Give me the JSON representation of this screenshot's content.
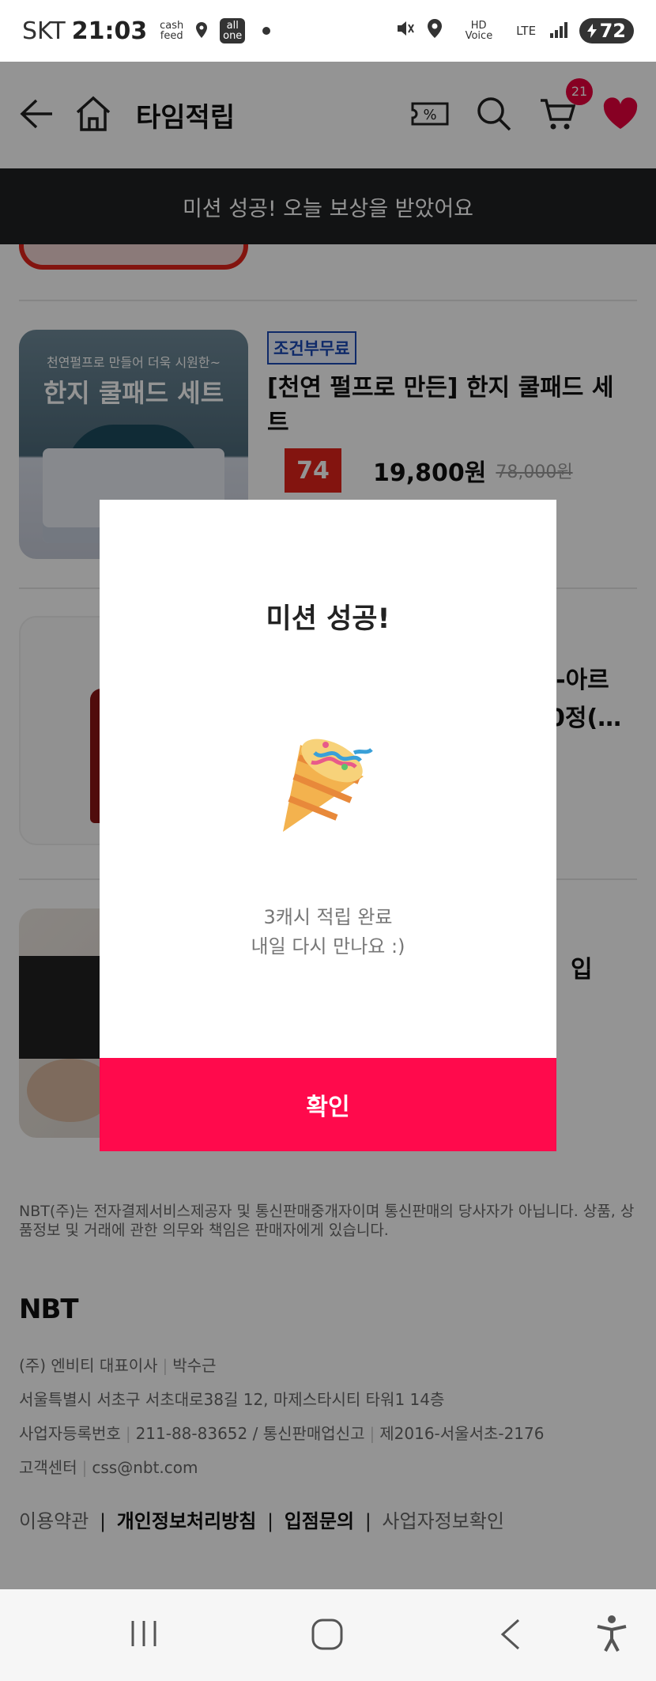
{
  "status_bar": {
    "carrier": "SKT",
    "time": "21:03",
    "mini_1": "cash feed",
    "mini_2": "all one",
    "net_1": "HD Voice",
    "net_2": "LTE",
    "battery": "72"
  },
  "header": {
    "title": "타임적립",
    "cart_count": "21",
    "coupon_symbol": "%"
  },
  "toast": {
    "text": "미션 성공! 오늘 보상을 받았어요"
  },
  "products": [
    {
      "thumb_line1": "천연펄프로 만들어 더욱 시원한~",
      "thumb_line2": "한지 쿨패드 세트",
      "tag": "조건부무료",
      "name": "[천연 펄프로 만든] 한지 쿨패드 세트",
      "discount": "74",
      "price": "19,800원",
      "original_price": "78,000원"
    },
    {
      "name_partial_1": "L-아르",
      "name_partial_2": "0정(…"
    },
    {
      "name_partial": "입"
    }
  ],
  "footer": {
    "notice": "NBT(주)는 전자결제서비스제공자 및 통신판매중개자이며 통신판매의 당사자가 아닙니다. 상품, 상품정보 및 거래에 관한 의무와 책임은 판매자에게 있습니다.",
    "logo": "NBT",
    "company": "(주) 엔비티 대표이사",
    "ceo": "박수근",
    "address": "서울특별시 서초구 서초대로38길 12, 마제스타시티 타워1 14층",
    "biz_label": "사업자등록번호",
    "biz_number": "211-88-83652 / 통신판매업신고",
    "mail_order": "제2016-서울서초-2176",
    "cs_label": "고객센터",
    "cs_email": "css@nbt.com",
    "links": [
      "이용약관",
      "개인정보처리방침",
      "입점문의",
      "사업자정보확인"
    ]
  },
  "modal": {
    "title": "미션 성공!",
    "message_line1": "3캐시 적립 완료",
    "message_line2": "내일 다시 만나요 :)",
    "confirm_label": "확인"
  },
  "colors": {
    "accent": "#ff0a4c",
    "toast_bg": "#1f2124",
    "discount": "#e2231a",
    "tag": "#1b49b6"
  }
}
